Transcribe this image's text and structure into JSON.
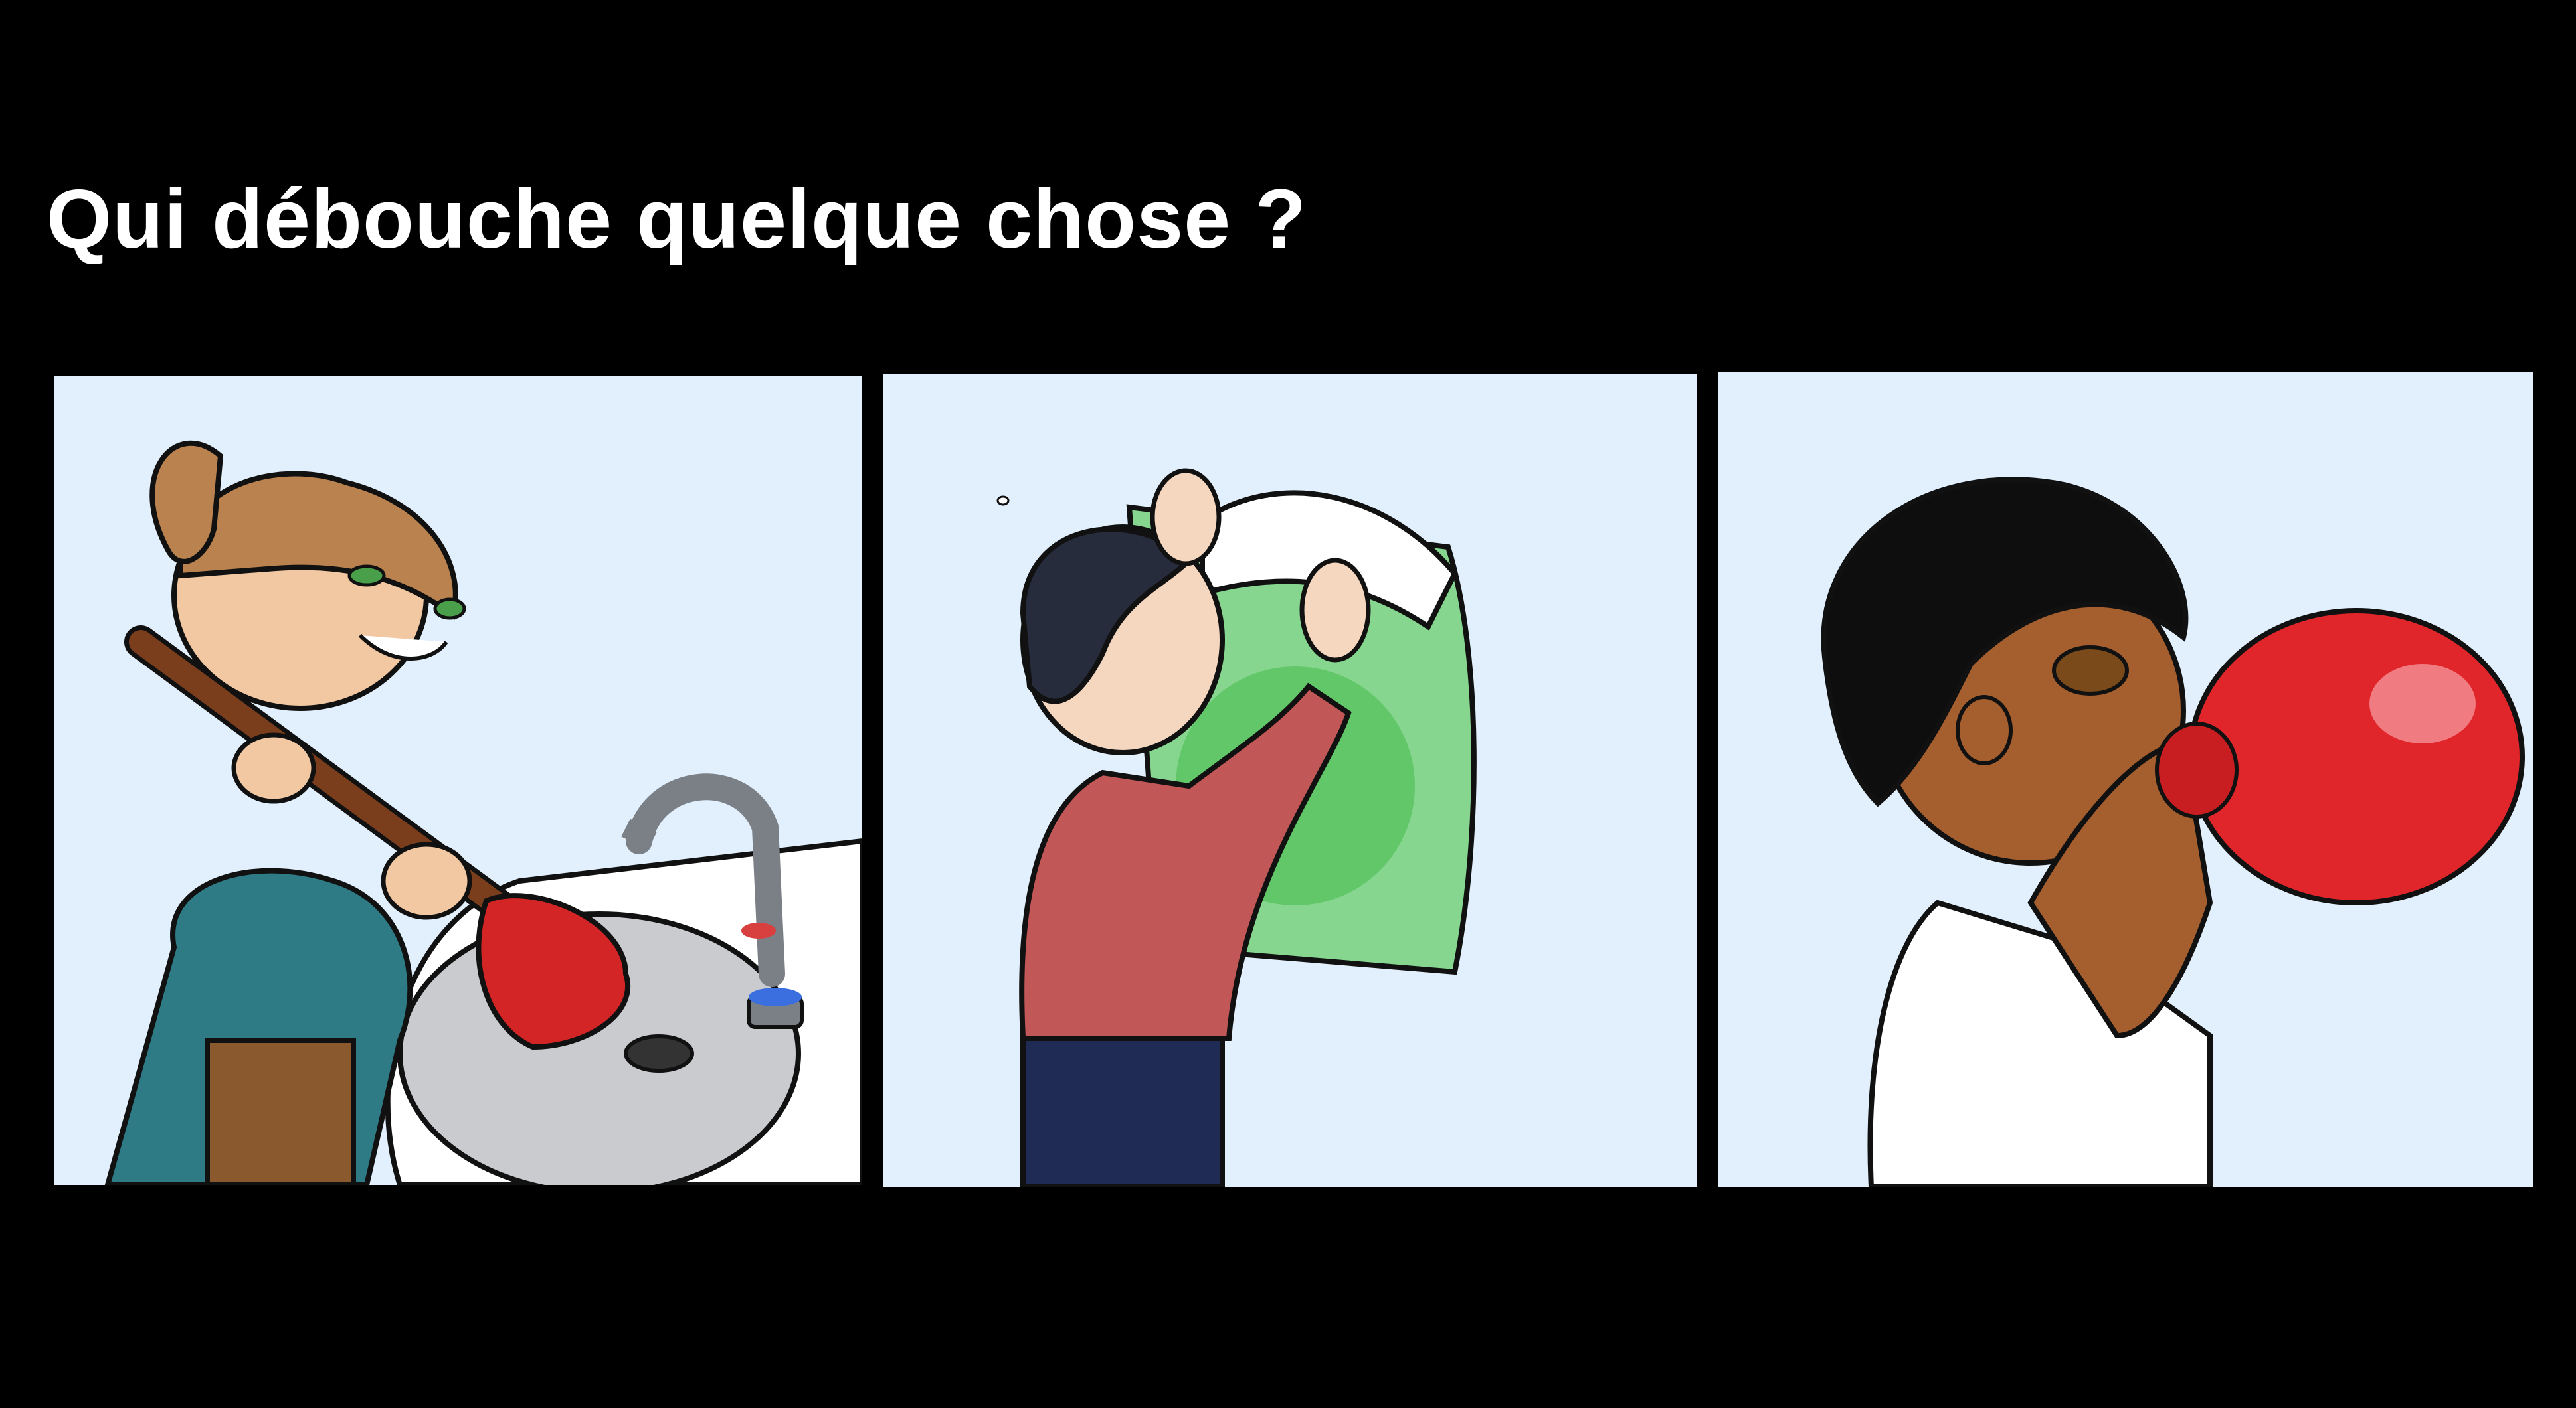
{
  "question": {
    "text": "Qui débouche quelque chose ?"
  },
  "panels": [
    {
      "icon": "plunger-sink-illustration"
    },
    {
      "icon": "poster-on-wall-illustration"
    },
    {
      "icon": "balloon-blowing-illustration"
    }
  ],
  "colors": {
    "background": "#000000",
    "panel_background": "#e1f0fc",
    "question_text": "#ffffff"
  }
}
